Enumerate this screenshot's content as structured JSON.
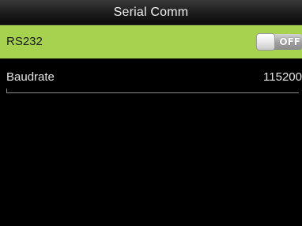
{
  "header": {
    "title": "Serial Comm"
  },
  "menu": {
    "items": [
      {
        "label": "RS232",
        "control": "toggle",
        "state_label": "OFF",
        "selected": true
      },
      {
        "label": "Baudrate",
        "value": "115200"
      }
    ]
  },
  "colors": {
    "selected_row": "#a6d250",
    "background": "#000000",
    "title_text": "#f2f2f2"
  }
}
